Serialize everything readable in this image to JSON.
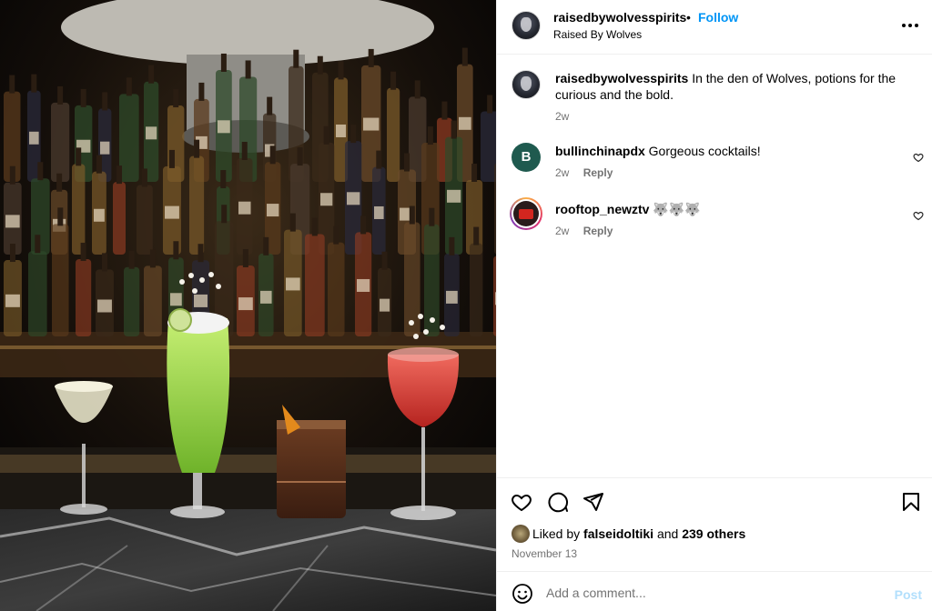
{
  "post": {
    "author": "raisedbywolvesspirits",
    "separator": "•",
    "follow_label": "Follow",
    "location": "Raised By Wolves"
  },
  "caption": {
    "username": "raisedbywolvesspirits",
    "text": "In the den of Wolves, potions for the curious and the bold.",
    "age": "2w"
  },
  "comments": [
    {
      "username": "bullinchinapdx",
      "text": "Gorgeous cocktails!",
      "age": "2w",
      "reply_label": "Reply",
      "avatar_letter": "B"
    },
    {
      "username": "rooftop_newztv",
      "text": "🐺🐺🐺",
      "age": "2w",
      "reply_label": "Reply"
    }
  ],
  "likes": {
    "prefix": "Liked by",
    "user": "falseidoltiki",
    "connector": "and",
    "others": "239 others"
  },
  "date": "November 13",
  "composer": {
    "placeholder": "Add a comment...",
    "post_label": "Post"
  },
  "icons": {
    "more": "more-options-icon",
    "like": "heart-icon",
    "comment": "comment-icon",
    "share": "share-icon",
    "save": "bookmark-icon",
    "emoji": "emoji-icon"
  },
  "colors": {
    "link": "#0095f6",
    "muted": "#737373",
    "post_disabled": "#b2dffc",
    "comment_avatar_bg": "#1f5a4f"
  }
}
